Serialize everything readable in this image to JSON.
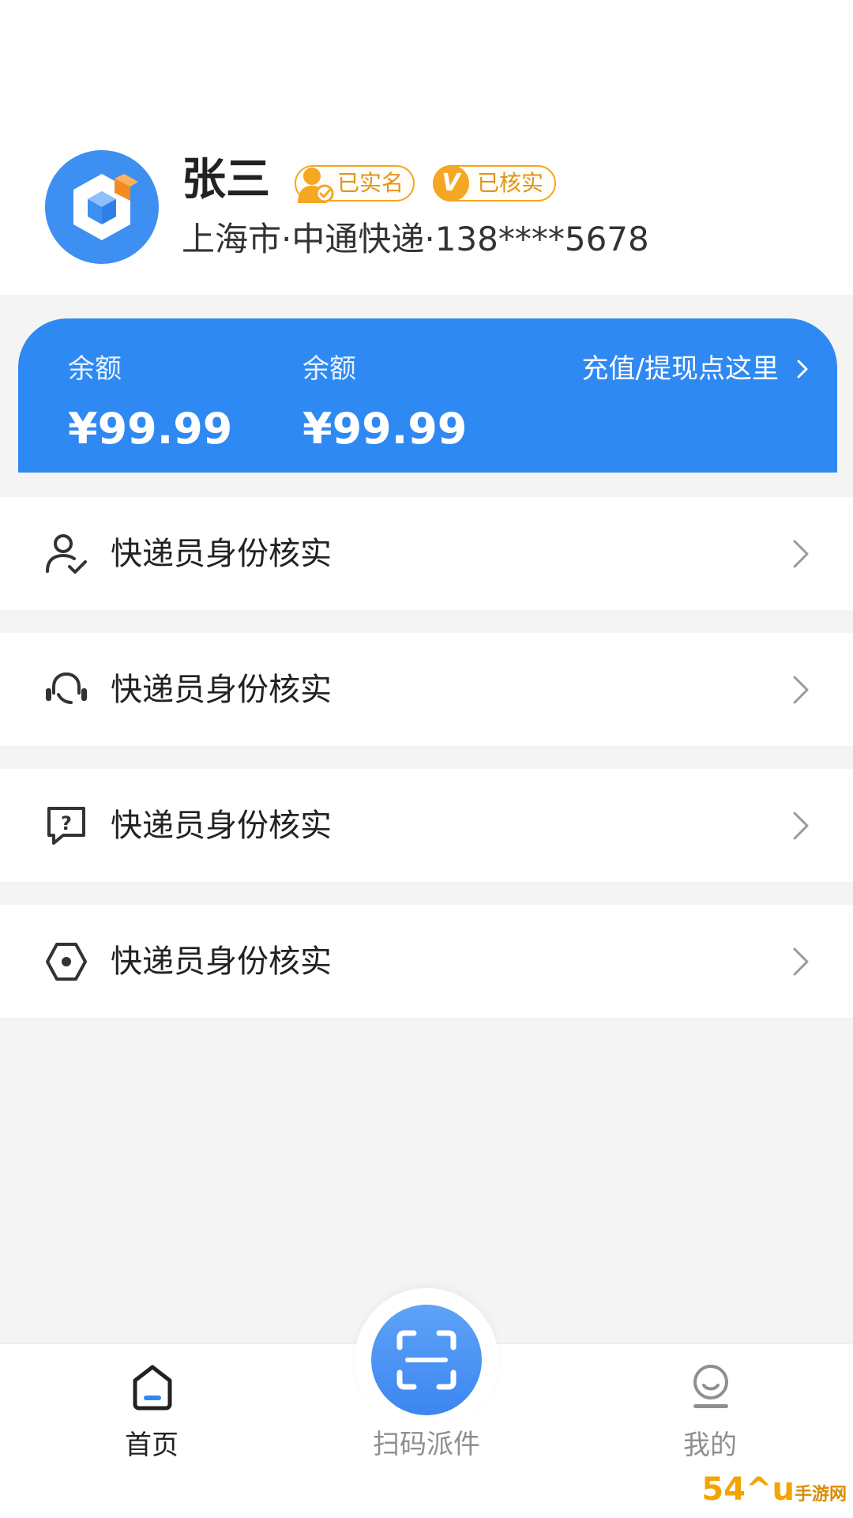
{
  "profile": {
    "name": "张三",
    "badges": {
      "realname": "已实名",
      "verified": "已核实",
      "verified_icon": "V"
    },
    "info": "上海市·中通快递·138****5678"
  },
  "balance": {
    "items": [
      {
        "label": "余额",
        "value": "¥99.99"
      },
      {
        "label": "余额",
        "value": "¥99.99"
      }
    ],
    "action_label": "充值/提现点这里"
  },
  "menu": {
    "items": [
      {
        "icon": "user-check-icon",
        "label": "快递员身份核实"
      },
      {
        "icon": "headset-icon",
        "label": "快递员身份核实"
      },
      {
        "icon": "question-chat-icon",
        "label": "快递员身份核实"
      },
      {
        "icon": "hexagon-settings-icon",
        "label": "快递员身份核实"
      }
    ]
  },
  "nav": {
    "home": "首页",
    "scan": "扫码派件",
    "mine": "我的"
  },
  "colors": {
    "primary": "#2e89f2",
    "badge": "#f5a623",
    "background": "#f4f4f4"
  },
  "watermark": {
    "main": "54^u",
    "sub": "手游网"
  }
}
